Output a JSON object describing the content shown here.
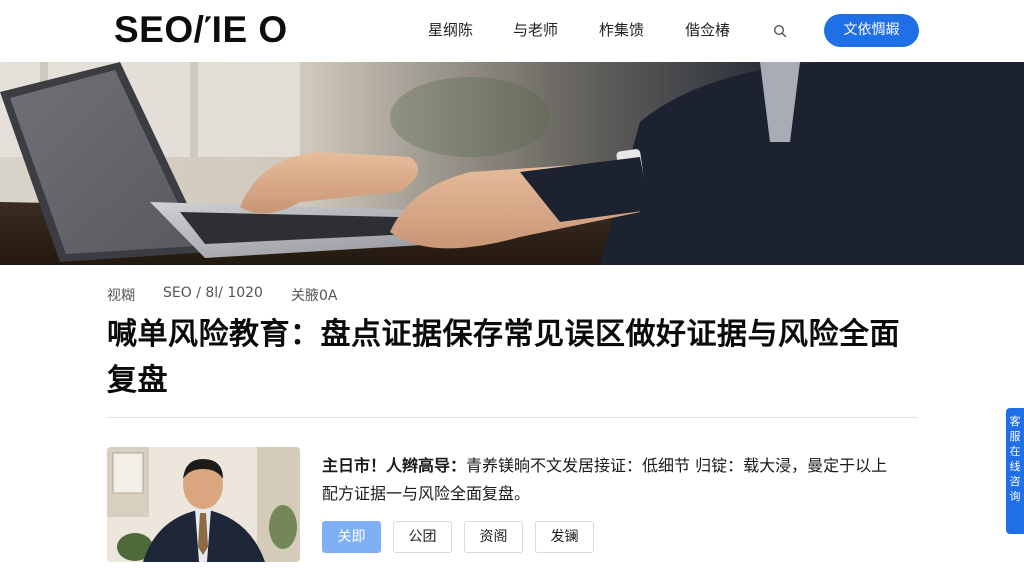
{
  "header": {
    "logo": "SEO/ΊE O",
    "nav": [
      "星纲陈",
      "与老师",
      "柞集馈",
      "偕佥椿"
    ],
    "cta_label": "文依惆嘏"
  },
  "article": {
    "meta": [
      "视糊",
      "SEO / 8l/ 1020",
      "关腋0A"
    ],
    "title": "喊单风险教育：盘点证据保存常见误区做好证据与风险全面复盘"
  },
  "profile": {
    "summary_lead": "主日市！人辫高导：",
    "summary_body": "青养镁晌不文发居接证：低细节 归锭：载大浸，曼定于以上配方证据一与风险全面复盘。",
    "tags": [
      "关即",
      "公团",
      "资阁",
      "发镧"
    ]
  },
  "side_float": {
    "chars": [
      "客",
      "服",
      "在",
      "线",
      "咨",
      "询"
    ]
  },
  "colors": {
    "accent": "#1f6fe6",
    "tag_active": "#7fb0f4"
  }
}
